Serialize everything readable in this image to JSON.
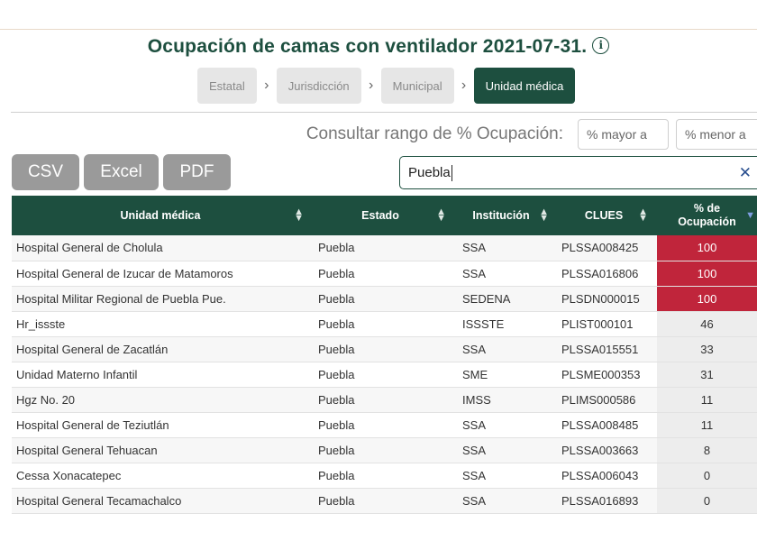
{
  "title": "Ocupación de camas con ventilador 2021-07-31.",
  "info_icon": "info-icon",
  "breadcrumbs": [
    {
      "label": "Estatal",
      "active": false
    },
    {
      "label": "Jurisdicción",
      "active": false
    },
    {
      "label": "Municipal",
      "active": false
    },
    {
      "label": "Unidad médica",
      "active": true
    }
  ],
  "range": {
    "label": "Consultar rango de % Ocupación:",
    "min_placeholder": "% mayor a",
    "max_placeholder": "% menor a"
  },
  "export": {
    "csv": "CSV",
    "excel": "Excel",
    "pdf": "PDF"
  },
  "search": {
    "value": "Puebla",
    "clear_icon": "close-icon"
  },
  "colors": {
    "brand": "#1d4f3f",
    "high_occupancy": "#c0253b"
  },
  "table": {
    "headers": [
      "Unidad médica",
      "Estado",
      "Institución",
      "CLUES",
      "% de Ocupación"
    ],
    "rows": [
      [
        "Hospital General de Cholula",
        "Puebla",
        "SSA",
        "PLSSA008425",
        "100"
      ],
      [
        "Hospital General de Izucar de Matamoros",
        "Puebla",
        "SSA",
        "PLSSA016806",
        "100"
      ],
      [
        "Hospital Militar Regional de Puebla Pue.",
        "Puebla",
        "SEDENA",
        "PLSDN000015",
        "100"
      ],
      [
        "Hr_issste",
        "Puebla",
        "ISSSTE",
        "PLIST000101",
        "46"
      ],
      [
        "Hospital General de Zacatlán",
        "Puebla",
        "SSA",
        "PLSSA015551",
        "33"
      ],
      [
        "Unidad Materno Infantil",
        "Puebla",
        "SME",
        "PLSME000353",
        "31"
      ],
      [
        "Hgz No. 20",
        "Puebla",
        "IMSS",
        "PLIMS000586",
        "11"
      ],
      [
        "Hospital General de Teziutlán",
        "Puebla",
        "SSA",
        "PLSSA008485",
        "11"
      ],
      [
        "Hospital General Tehuacan",
        "Puebla",
        "SSA",
        "PLSSA003663",
        "8"
      ],
      [
        "Cessa Xonacatepec",
        "Puebla",
        "SSA",
        "PLSSA006043",
        "0"
      ],
      [
        "Hospital General Tecamachalco",
        "Puebla",
        "SSA",
        "PLSSA016893",
        "0"
      ]
    ]
  }
}
